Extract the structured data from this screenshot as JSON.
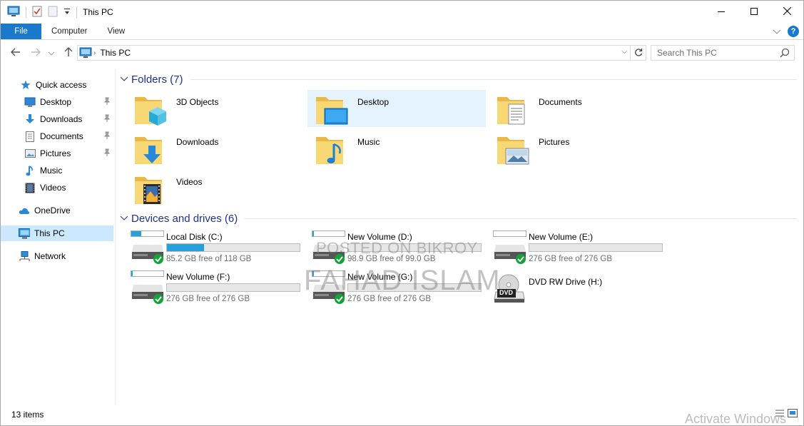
{
  "window": {
    "title": "This PC",
    "quick_access_toolbar": [
      "computer-icon",
      "properties-icon",
      "new-folder-icon",
      "customize-dropdown-icon"
    ],
    "controls": [
      "minimize-icon",
      "maximize-icon",
      "close-icon"
    ]
  },
  "ribbon": {
    "tabs": [
      {
        "label": "File",
        "active": true
      },
      {
        "label": "Computer"
      },
      {
        "label": "View"
      }
    ],
    "accent": "#1979ca"
  },
  "address": {
    "path": "This PC",
    "search_placeholder": "Search This PC"
  },
  "nav": {
    "items": [
      {
        "label": "Quick access",
        "icon": "star-icon"
      },
      {
        "label": "Desktop",
        "icon": "desktop-icon",
        "pinned": true
      },
      {
        "label": "Downloads",
        "icon": "download-arrow-icon",
        "pinned": true
      },
      {
        "label": "Documents",
        "icon": "document-icon",
        "pinned": true
      },
      {
        "label": "Pictures",
        "icon": "pictures-icon",
        "pinned": true
      },
      {
        "label": "Music",
        "icon": "music-note-icon"
      },
      {
        "label": "Videos",
        "icon": "film-icon"
      },
      {
        "label": "OneDrive",
        "icon": "cloud-icon"
      },
      {
        "label": "This PC",
        "icon": "computer-icon",
        "selected": true
      },
      {
        "label": "Network",
        "icon": "network-icon"
      }
    ]
  },
  "folders": {
    "header": "Folders (7)",
    "items": [
      {
        "name": "3D Objects",
        "icon": "cube-folder-icon"
      },
      {
        "name": "Desktop",
        "icon": "desktop-folder-icon",
        "selected": true
      },
      {
        "name": "Documents",
        "icon": "documents-folder-icon"
      },
      {
        "name": "Downloads",
        "icon": "downloads-folder-icon"
      },
      {
        "name": "Music",
        "icon": "music-folder-icon"
      },
      {
        "name": "Pictures",
        "icon": "pictures-folder-icon"
      },
      {
        "name": "Videos",
        "icon": "videos-folder-icon"
      }
    ]
  },
  "drives": {
    "header": "Devices and drives (6)",
    "items": [
      {
        "name": "Local Disk (C:)",
        "free": "85.2 GB free of 118 GB",
        "used_fraction": 0.28,
        "icon": "hard-drive-icon"
      },
      {
        "name": "New Volume (D:)",
        "free": "98.9 GB free of 99.0 GB",
        "used_fraction": 0.0,
        "icon": "hard-drive-icon"
      },
      {
        "name": "New Volume (E:)",
        "free": "276 GB free of 276 GB",
        "used_fraction": 0.0,
        "icon": "hard-drive-icon"
      },
      {
        "name": "New Volume (F:)",
        "free": "276 GB free of 276 GB",
        "used_fraction": 0.0,
        "icon": "hard-drive-icon"
      },
      {
        "name": "New Volume (G:)",
        "free": "276 GB free of 276 GB",
        "used_fraction": 0.0,
        "icon": "hard-drive-icon"
      },
      {
        "name": "DVD RW Drive (H:)",
        "icon": "dvd-drive-icon",
        "disc_label": "DVD"
      }
    ]
  },
  "status": {
    "item_count": "13 items"
  },
  "watermarks": {
    "line1": "POSTED ON BIKROY",
    "line2": "FAHAD ISLAM",
    "activate": "Activate Windows"
  }
}
